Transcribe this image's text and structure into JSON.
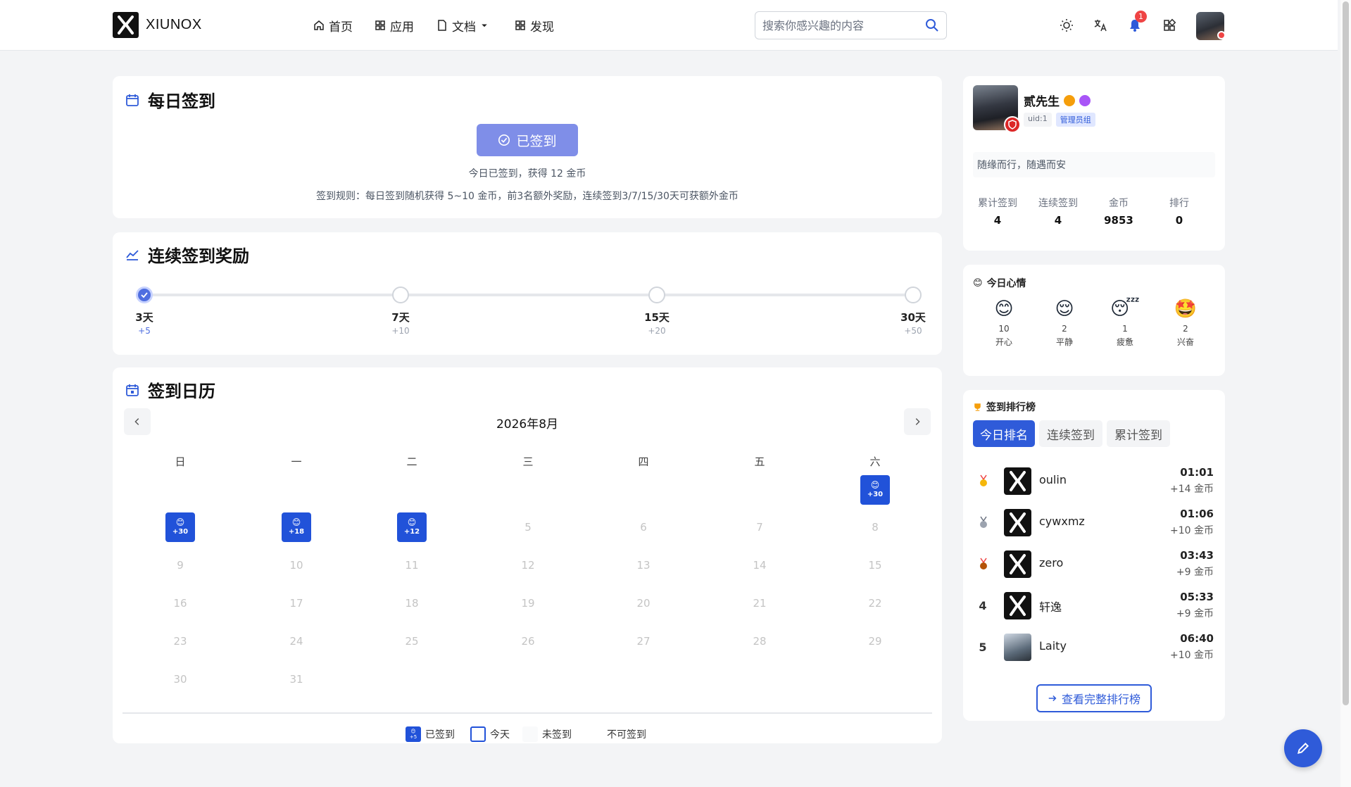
{
  "brand": {
    "name": "XIUNOX"
  },
  "nav": {
    "items": [
      {
        "label": "首页",
        "icon": "home-icon"
      },
      {
        "label": "应用",
        "icon": "apps-icon"
      },
      {
        "label": "文档",
        "icon": "document-icon"
      },
      {
        "label": "发现",
        "icon": "grid-icon"
      }
    ]
  },
  "search": {
    "placeholder": "搜索你感兴趣的内容"
  },
  "header": {
    "notification_count": "1"
  },
  "daily": {
    "title": "每日签到",
    "button_label": "已签到",
    "status_text": "今日已签到，获得 12 金币",
    "rule_text": "签到规则：每日签到随机获得 5~10 金币，前3名额外奖励，连续签到3/7/15/30天可获额外金币"
  },
  "streak": {
    "title": "连续签到奖励",
    "milestones": [
      {
        "label": "3天",
        "bonus": "+5",
        "achieved": true
      },
      {
        "label": "7天",
        "bonus": "+10",
        "achieved": false
      },
      {
        "label": "15天",
        "bonus": "+20",
        "achieved": false
      },
      {
        "label": "30天",
        "bonus": "+50",
        "achieved": false
      }
    ]
  },
  "calendar": {
    "title": "签到日历",
    "month": "2026年8月",
    "weekdays": [
      "日",
      "一",
      "二",
      "三",
      "四",
      "五",
      "六"
    ],
    "signed": [
      {
        "day": "1",
        "emoji": "😊",
        "points": "+30"
      },
      {
        "day": "2",
        "emoji": "😊",
        "points": "+30"
      },
      {
        "day": "3",
        "emoji": "😊",
        "points": "+18"
      },
      {
        "day": "4",
        "emoji": "😊",
        "points": "+12"
      }
    ],
    "days": [
      "5",
      "6",
      "7",
      "8",
      "9",
      "10",
      "11",
      "12",
      "13",
      "14",
      "15",
      "16",
      "17",
      "18",
      "19",
      "20",
      "21",
      "22",
      "23",
      "24",
      "25",
      "26",
      "27",
      "28",
      "29",
      "30",
      "31"
    ],
    "legend": {
      "signed": "已签到",
      "signed_chip": "+5",
      "today": "今天",
      "unsigned": "未签到",
      "unavailable": "不可签到"
    }
  },
  "profile": {
    "name": "贰先生",
    "uid": "uid:1",
    "group": "管理员组",
    "motto": "随缘而行，随遇而安",
    "stats": [
      {
        "label": "累计签到",
        "value": "4"
      },
      {
        "label": "连续签到",
        "value": "4"
      },
      {
        "label": "金币",
        "value": "9853"
      },
      {
        "label": "排行",
        "value": "0"
      }
    ]
  },
  "mood": {
    "title": "今日心情",
    "items": [
      {
        "emoji": "😊",
        "count": "10",
        "label": "开心"
      },
      {
        "emoji": "😌",
        "count": "2",
        "label": "平静"
      },
      {
        "emoji": "😴",
        "count": "1",
        "label": "疲惫"
      },
      {
        "emoji": "🤩",
        "count": "2",
        "label": "兴奋"
      }
    ]
  },
  "leaderboard": {
    "title": "签到排行榜",
    "tabs": [
      "今日排名",
      "连续签到",
      "累计签到"
    ],
    "active_tab": "今日排名",
    "rows": [
      {
        "rank": "1",
        "name": "oulin",
        "time": "01:01",
        "coins": "+14 金币",
        "medal": "gold-medal-icon"
      },
      {
        "rank": "2",
        "name": "cywxmz",
        "time": "01:06",
        "coins": "+10 金币",
        "medal": "silver-medal-icon"
      },
      {
        "rank": "3",
        "name": "zero",
        "time": "03:43",
        "coins": "+9 金币",
        "medal": "bronze-medal-icon"
      },
      {
        "rank": "4",
        "name": "轩逸",
        "time": "05:33",
        "coins": "+9 金币"
      },
      {
        "rank": "5",
        "name": "Laity",
        "time": "06:40",
        "coins": "+10 金币"
      }
    ],
    "full_button": "查看完整排行榜"
  },
  "colors": {
    "primary": "#2f5bd9",
    "checked_button": "#7f8ee8",
    "signed_day": "#2152d9",
    "badge": "#ef4444"
  }
}
